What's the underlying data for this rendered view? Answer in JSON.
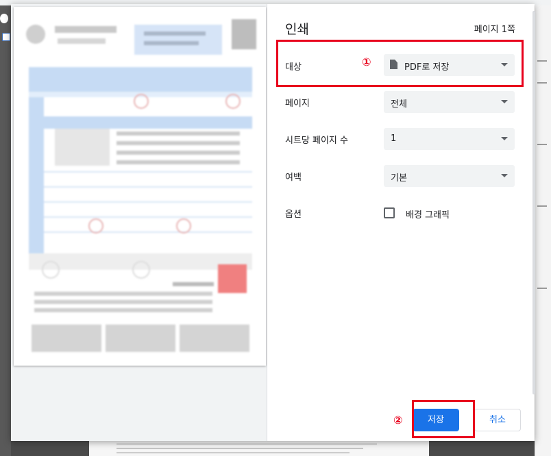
{
  "dialog": {
    "title": "인쇄",
    "page_count": "페이지 1쪽",
    "destination": {
      "label": "대상",
      "value": "PDF로 저장",
      "icon": "document-icon"
    },
    "pages": {
      "label": "페이지",
      "value": "전체"
    },
    "pages_per_sheet": {
      "label": "시트당 페이지 수",
      "value": "1"
    },
    "margins": {
      "label": "여백",
      "value": "기본"
    },
    "options": {
      "label": "옵션",
      "background_graphics_label": "배경 그래픽",
      "background_graphics_checked": false
    },
    "buttons": {
      "save": "저장",
      "cancel": "취소"
    },
    "annotations": {
      "step1": "①",
      "step2": "②"
    }
  },
  "colors": {
    "accent": "#1a73e8",
    "annotation_red": "#e8001c",
    "select_bg": "#f1f3f4"
  }
}
